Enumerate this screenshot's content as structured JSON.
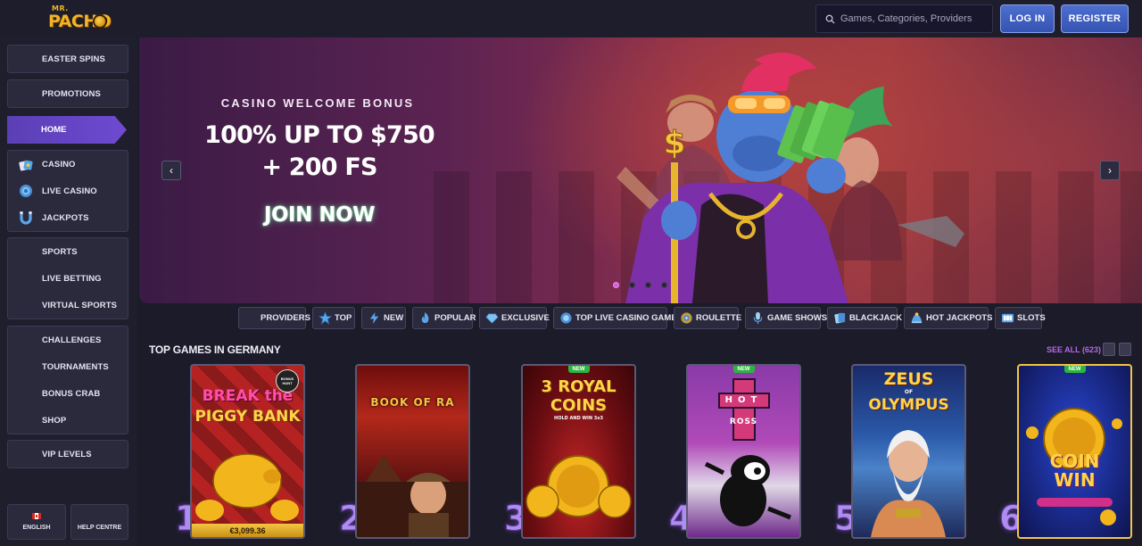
{
  "header": {
    "logo_top": "MR.",
    "logo_main": "PACHO",
    "search": {
      "placeholder": "Games, Categories, Providers"
    },
    "login_label": "LOG IN",
    "register_label": "REGISTER"
  },
  "sidebar": {
    "groups": [
      {
        "items": [
          {
            "label": "EASTER SPINS"
          }
        ]
      },
      {
        "items": [
          {
            "label": "PROMOTIONS"
          }
        ]
      },
      {
        "items": [
          {
            "label": "HOME",
            "active": true
          }
        ]
      },
      {
        "items": [
          {
            "label": "CASINO",
            "icon": "cards-icon"
          },
          {
            "label": "LIVE CASINO",
            "icon": "globe-icon"
          },
          {
            "label": "JACKPOTS",
            "icon": "magnet-icon"
          }
        ]
      },
      {
        "items": [
          {
            "label": "SPORTS"
          },
          {
            "label": "LIVE BETTING"
          },
          {
            "label": "VIRTUAL SPORTS"
          }
        ]
      },
      {
        "items": [
          {
            "label": "CHALLENGES"
          },
          {
            "label": "TOURNAMENTS"
          },
          {
            "label": "BONUS CRAB"
          },
          {
            "label": "SHOP"
          }
        ]
      },
      {
        "items": [
          {
            "label": "VIP LEVELS"
          }
        ]
      }
    ],
    "language_label": "ENGLISH",
    "help_label": "HELP CENTRE"
  },
  "hero": {
    "kicker": "CASINO WELCOME BONUS",
    "offer_line1": "100% UP TO $750",
    "offer_line2": "+ 200 FS",
    "cta": "JOIN NOW",
    "slides": 4,
    "active_slide": 1
  },
  "categories": [
    {
      "label": "PROVIDERS",
      "icon": "none"
    },
    {
      "label": "TOP",
      "icon": "star-icon"
    },
    {
      "label": "NEW",
      "icon": "lightning-icon"
    },
    {
      "label": "POPULAR",
      "icon": "flame-icon"
    },
    {
      "label": "EXCLUSIVE",
      "icon": "diamond-icon"
    },
    {
      "label": "TOP LIVE CASINO GAMES",
      "icon": "live-icon"
    },
    {
      "label": "ROULETTE",
      "icon": "roulette-icon"
    },
    {
      "label": "GAME SHOWS",
      "icon": "microphone-icon"
    },
    {
      "label": "BLACKJACK",
      "icon": "cards-icon"
    },
    {
      "label": "HOT JACKPOTS",
      "icon": "jackpot-icon"
    },
    {
      "label": "SLOTS",
      "icon": "slot-icon"
    }
  ],
  "top_games": {
    "title": "TOP GAMES IN GERMANY",
    "see_all": "SEE ALL (623)",
    "games": [
      {
        "rank": "1",
        "title_line1": "BREAK the",
        "title_line2": "PIGGY BANK",
        "jackpot": "€3,099.36",
        "badge": "BONUS HUNT"
      },
      {
        "rank": "2",
        "title_line1": "BOOK OF RA",
        "title_line2": ""
      },
      {
        "rank": "3",
        "title_line1": "3 ROYAL",
        "title_line2": "COINS",
        "subtitle": "HOLD AND WIN 3x3",
        "new": "NEW"
      },
      {
        "rank": "4",
        "title_line1": "HOT",
        "title_line2": "ROSS",
        "new": "NEW"
      },
      {
        "rank": "5",
        "title_line1": "ZEUS",
        "title_line2": "OLYMPUS",
        "of": "OF"
      },
      {
        "rank": "6",
        "title_line1": "COIN",
        "title_line2": "WIN",
        "new": "NEW"
      }
    ]
  },
  "colors": {
    "accent": "#6e4ad0",
    "button": "#3553b2",
    "see_all": "#b36ae6",
    "new_badge": "#2bb53f"
  }
}
